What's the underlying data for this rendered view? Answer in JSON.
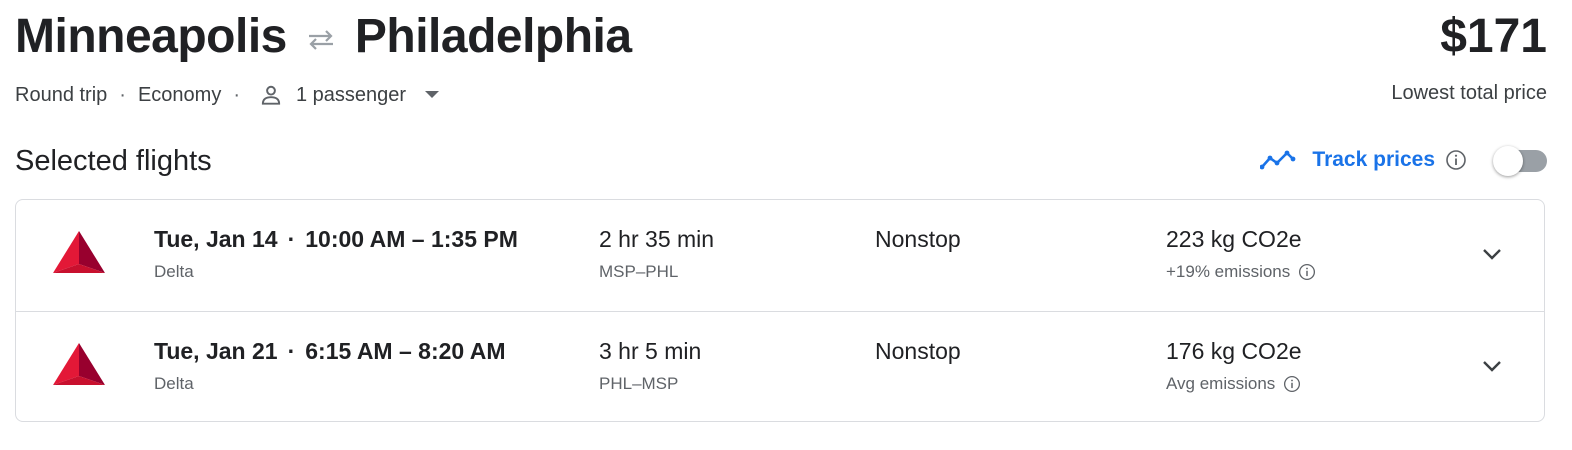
{
  "header": {
    "origin": "Minneapolis",
    "destination": "Philadelphia",
    "swap_icon": "swap-arrows-icon",
    "price": "$171",
    "price_label": "Lowest total price"
  },
  "options": {
    "trip_type": "Round trip",
    "cabin": "Economy",
    "passengers": "1 passenger",
    "separator": "·"
  },
  "section": {
    "title": "Selected flights",
    "track_label": "Track prices",
    "track_enabled": false
  },
  "flights": [
    {
      "date": "Tue, Jan 14",
      "times": "10:00 AM – 1:35 PM",
      "airline": "Delta",
      "duration": "2 hr 35 min",
      "route": "MSP–PHL",
      "stops": "Nonstop",
      "co2": "223 kg CO2e",
      "emissions": "+19% emissions"
    },
    {
      "date": "Tue, Jan 21",
      "times": "6:15 AM – 8:20 AM",
      "airline": "Delta",
      "duration": "3 hr 5 min",
      "route": "PHL–MSP",
      "stops": "Nonstop",
      "co2": "176 kg CO2e",
      "emissions": "Avg emissions"
    }
  ],
  "colors": {
    "accent": "#1a73e8",
    "text": "#202124",
    "secondary": "#5f6368",
    "border": "#dadce0",
    "toggle_off": "#9aa0a6",
    "delta_red": "#c8102e"
  }
}
